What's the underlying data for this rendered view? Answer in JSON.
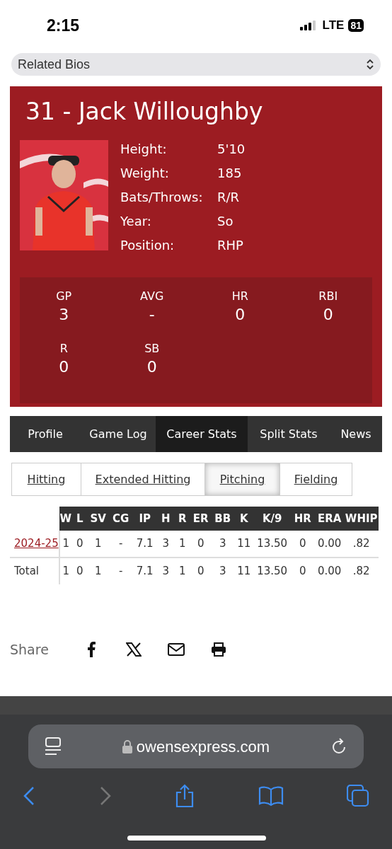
{
  "status_bar": {
    "time": "2:15",
    "network": "LTE",
    "battery": "81"
  },
  "related_bios": {
    "value": "Related Bios"
  },
  "player": {
    "title": "31 - Jack Willoughby",
    "bio": [
      {
        "label": "Height:",
        "value": "5'10"
      },
      {
        "label": "Weight:",
        "value": "185"
      },
      {
        "label": "Bats/Throws:",
        "value": "R/R"
      },
      {
        "label": "Year:",
        "value": "So"
      },
      {
        "label": "Position:",
        "value": "RHP"
      }
    ],
    "stats": [
      {
        "label": "GP",
        "value": "3"
      },
      {
        "label": "AVG",
        "value": "-"
      },
      {
        "label": "HR",
        "value": "0"
      },
      {
        "label": "RBI",
        "value": "0"
      },
      {
        "label": "R",
        "value": "0"
      },
      {
        "label": "SB",
        "value": "0"
      }
    ]
  },
  "tabs": [
    {
      "label": "Profile",
      "selected": false
    },
    {
      "label": "Game Log",
      "selected": false
    },
    {
      "label": "Career Stats",
      "selected": true
    },
    {
      "label": "Split Stats",
      "selected": false
    },
    {
      "label": "News",
      "selected": false
    }
  ],
  "stat_tabs": [
    {
      "label": "Hitting",
      "selected": false
    },
    {
      "label": "Extended Hitting",
      "selected": false
    },
    {
      "label": "Pitching",
      "selected": true
    },
    {
      "label": "Fielding",
      "selected": false
    }
  ],
  "table": {
    "columns": [
      "W",
      "L",
      "SV",
      "CG",
      "IP",
      "H",
      "R",
      "ER",
      "BB",
      "K",
      "K/9",
      "HR",
      "ERA",
      "WHIP"
    ],
    "rows": [
      {
        "kind": "link",
        "season": "2024-25",
        "cells": [
          "1",
          "0",
          "1",
          "-",
          "7.1",
          "3",
          "1",
          "0",
          "3",
          "11",
          "13.50",
          "0",
          "0.00",
          ".82"
        ]
      },
      {
        "kind": "total",
        "season": "Total",
        "cells": [
          "1",
          "0",
          "1",
          "-",
          "7.1",
          "3",
          "1",
          "0",
          "3",
          "11",
          "13.50",
          "0",
          "0.00",
          ".82"
        ]
      }
    ]
  },
  "share": {
    "label": "Share"
  },
  "browser": {
    "url": "owensexpress.com"
  }
}
